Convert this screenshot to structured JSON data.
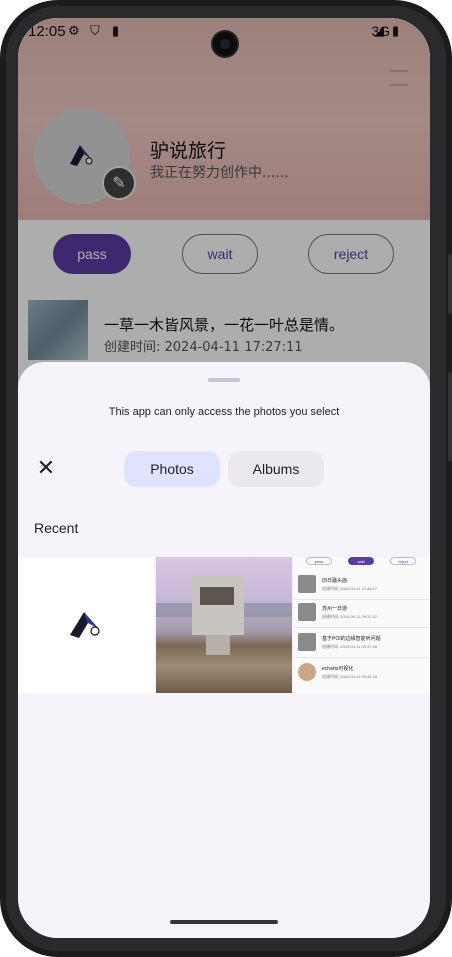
{
  "status_bar": {
    "time": "12:05",
    "network": "3G"
  },
  "profile": {
    "name": "驴说旅行",
    "subtitle": "我正在努力创作中......"
  },
  "filters": {
    "pass": "pass",
    "wait": "wait",
    "reject": "reject"
  },
  "post": {
    "title": "一草一木皆风景，一花一叶总是情。",
    "date": "创建时间: 2024-04-11 17:27:11"
  },
  "picker": {
    "notice": "This app can only access the photos you select",
    "close_icon": "close-icon",
    "tabs": {
      "photos": "Photos",
      "albums": "Albums"
    },
    "section": "Recent",
    "tab_active_color": "#dfe3ff",
    "tab_inactive_color": "#ebe8ee"
  },
  "screenshot_thumb": {
    "buttons": [
      "pass",
      "wait",
      "reject"
    ],
    "rows": [
      {
        "title": "旧日骚头庙",
        "date": "创建时间: 2024-04-11 13:48:07"
      },
      {
        "title": "苏州一日游",
        "date": "创建时间: 2024-04-11 09:31:32"
      },
      {
        "title": "基于POI的边缘智能听问题",
        "date": "创建时间: 2024-04-11 09:37:45"
      },
      {
        "title": "echarts可视化",
        "date": "创建时间: 2024-04-11 09:44:34"
      }
    ]
  },
  "colors": {
    "accent": "#5c3da6",
    "sheet_bg": "#f7f3fb"
  }
}
